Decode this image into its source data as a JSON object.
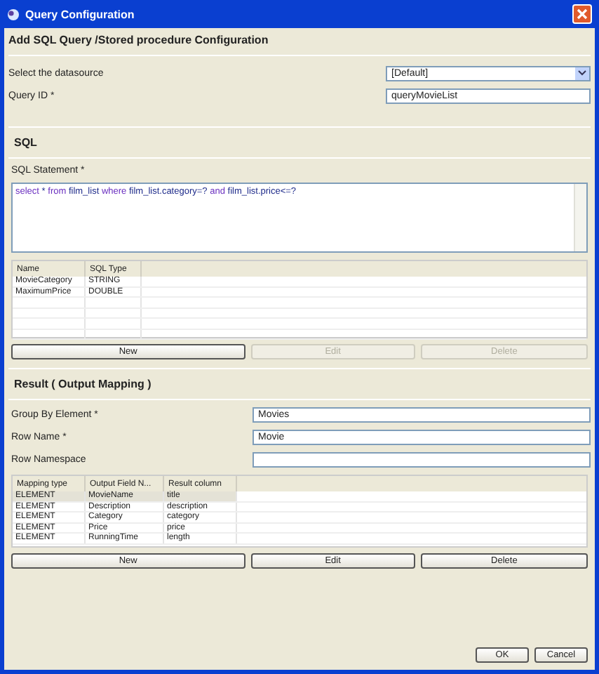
{
  "window": {
    "title": "Query Configuration"
  },
  "header": "Add SQL Query /Stored procedure Configuration",
  "datasource": {
    "label": "Select the datasource",
    "value": "[Default]"
  },
  "query_id": {
    "label": "Query ID *",
    "value": "queryMovieList"
  },
  "sql": {
    "heading": "SQL",
    "statement_label": "SQL Statement *",
    "statement": [
      {
        "kind": "keyword",
        "text": "select"
      },
      {
        "kind": "plain",
        "text": "*"
      },
      {
        "kind": "keyword",
        "text": "from"
      },
      {
        "kind": "plain",
        "text": "film_list"
      },
      {
        "kind": "keyword",
        "text": "where"
      },
      {
        "kind": "plain",
        "text": "film_list.category=?"
      },
      {
        "kind": "keyword",
        "text": "and"
      },
      {
        "kind": "plain",
        "text": "film_list.price<=?"
      }
    ],
    "params": {
      "columns": [
        "Name",
        "SQL Type"
      ],
      "rows": [
        [
          "MovieCategory",
          "STRING"
        ],
        [
          "MaximumPrice",
          "DOUBLE"
        ]
      ]
    },
    "buttons": [
      {
        "label": "New",
        "disabled": false
      },
      {
        "label": "Edit",
        "disabled": true
      },
      {
        "label": "Delete",
        "disabled": true
      }
    ]
  },
  "result": {
    "heading": "Result ( Output Mapping )",
    "fields": [
      {
        "label": "Group By Element *",
        "value": "Movies"
      },
      {
        "label": "Row Name *",
        "value": "Movie"
      },
      {
        "label": "Row Namespace"
      }
    ],
    "mapping": {
      "columns": [
        "Mapping type",
        "Output Field N...",
        "Result column"
      ],
      "rows": [
        {
          "cells": [
            "ELEMENT",
            "MovieName",
            "title"
          ],
          "selected": true
        },
        {
          "cells": [
            "ELEMENT",
            "Description",
            "description"
          ],
          "selected": false
        },
        {
          "cells": [
            "ELEMENT",
            "Category",
            "category"
          ],
          "selected": false
        },
        {
          "cells": [
            "ELEMENT",
            "Price",
            "price"
          ],
          "selected": false
        },
        {
          "cells": [
            "ELEMENT",
            "RunningTime",
            "length"
          ],
          "selected": false
        }
      ]
    },
    "buttons": [
      {
        "label": "New",
        "disabled": false
      },
      {
        "label": "Edit",
        "disabled": false
      },
      {
        "label": "Delete",
        "disabled": false
      }
    ]
  },
  "footer_buttons": [
    "OK",
    "Cancel"
  ]
}
